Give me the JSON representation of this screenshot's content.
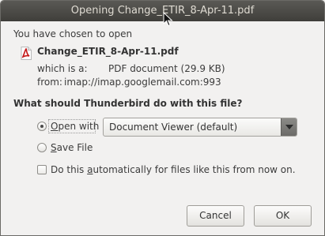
{
  "window": {
    "title": "Opening Change_ETIR_8-Apr-11.pdf"
  },
  "file": {
    "intro": "You have chosen to open",
    "name": "Change_ETIR_8-Apr-11.pdf",
    "type_label": "which is a:",
    "type_value": "PDF document (29.9  KB)",
    "from_label": "from:",
    "from_value": "imap://imap.googlemail.com:993",
    "icon": "pdf-icon"
  },
  "question": "What should Thunderbird do with this file?",
  "options": {
    "open_with": {
      "prefix": "",
      "accel": "O",
      "rest": "pen with",
      "selected": true
    },
    "application": {
      "value": "Document Viewer (default)"
    },
    "save_file": {
      "prefix": "",
      "accel": "S",
      "rest": "ave File",
      "selected": false
    }
  },
  "auto": {
    "prefix": "Do this ",
    "accel": "a",
    "rest": "utomatically for files like this from now on.",
    "checked": false
  },
  "buttons": {
    "cancel": "Cancel",
    "ok": "OK"
  },
  "colors": {
    "titlebar": "#4a4945",
    "pdf_red": "#c41818"
  }
}
